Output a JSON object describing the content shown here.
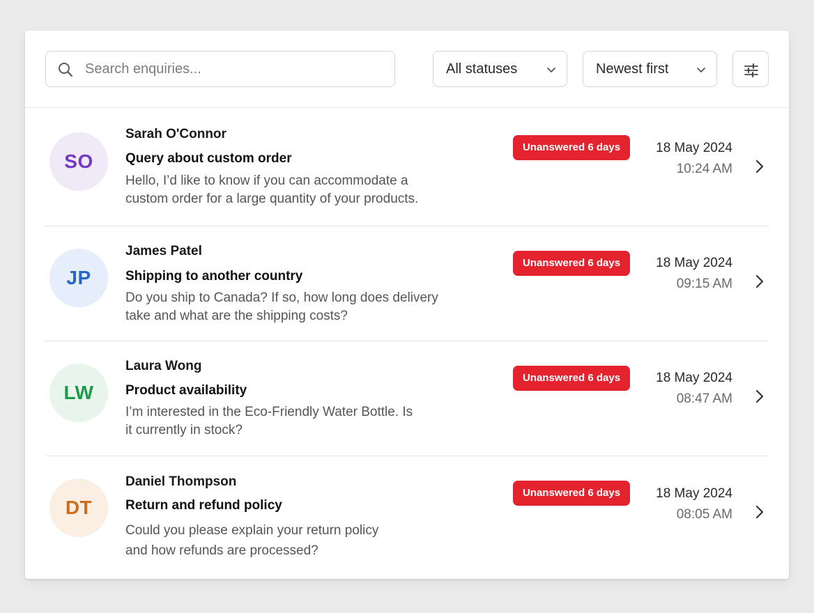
{
  "search": {
    "placeholder": "Search enquiries..."
  },
  "filters": {
    "status": {
      "selected": "All statuses"
    },
    "sort": {
      "selected": "Newest first"
    }
  },
  "enquiries": [
    {
      "initials": "SO",
      "name": "Sarah O'Connor",
      "subject": "Query about custom order",
      "preview": "Hello, I’d like to know if you can accommodate a custom order for a large quantity of your products.",
      "badge": "Unanswered 6 days",
      "date": "18 May 2024",
      "time": "10:24 AM",
      "avatar_bg": "#efe9f8",
      "avatar_fg": "#7438c3"
    },
    {
      "initials": "JP",
      "name": "James Patel",
      "subject": "Shipping to another country",
      "preview": "Do you ship to Canada? If so, how long does delivery take and what are the shipping costs?",
      "badge": "Unanswered 6 days",
      "date": "18 May 2024",
      "time": "09:15 AM",
      "avatar_bg": "#e6eefb",
      "avatar_fg": "#2a66c6"
    },
    {
      "initials": "LW",
      "name": "Laura Wong",
      "subject": "Product availability",
      "preview": "I’m interested in the Eco-Friendly Water Bottle. Is it currently in stock?",
      "badge": "Unanswered 6 days",
      "date": "18 May 2024",
      "time": "08:47 AM",
      "avatar_bg": "#e7f5ec",
      "avatar_fg": "#1f9a4b"
    },
    {
      "initials": "DT",
      "name": "Daniel Thompson",
      "subject": "Return and refund policy",
      "preview": "Could you please explain your return policy and how refunds are processed?",
      "badge": "Unanswered 6 days",
      "date": "18 May 2024",
      "time": "08:05 AM",
      "avatar_bg": "#fbeee3",
      "avatar_fg": "#cf6d1c"
    }
  ],
  "colors": {
    "badge": "#e5232f",
    "border": "#e6e6e6",
    "background": "#ebebeb"
  },
  "icons": {
    "search": "search-icon",
    "chevron_down": "chevron-down-icon",
    "filter": "sliders-icon",
    "row_chevron": "chevron-right-icon"
  }
}
